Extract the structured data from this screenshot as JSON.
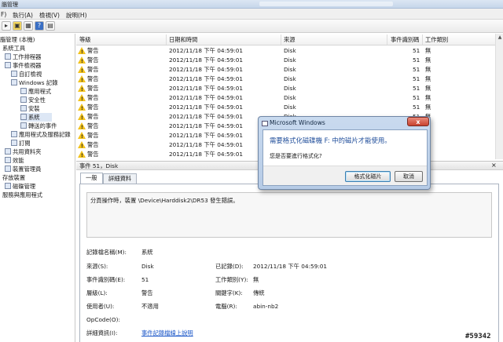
{
  "window": {
    "title": "腦管理"
  },
  "menu": [
    {
      "label": "F)"
    },
    {
      "label": "執行(A)"
    },
    {
      "label": "檢視(V)"
    },
    {
      "label": "說明(H)"
    }
  ],
  "toolbar": {
    "buttons": [
      {
        "icon": "back-icon",
        "glyph": "▸"
      },
      {
        "icon": "folder-icon",
        "glyph": "▣"
      },
      {
        "icon": "grid-icon",
        "glyph": "▦"
      },
      {
        "icon": "help-icon",
        "glyph": "?"
      },
      {
        "icon": "properties-icon",
        "glyph": "▤"
      }
    ]
  },
  "tree": {
    "items": [
      {
        "label": "腦管理 (本機)"
      },
      {
        "label": "系統工具"
      },
      {
        "label": "工作排程器"
      },
      {
        "label": "事件檢視器"
      },
      {
        "label": "自訂檢視"
      },
      {
        "label": "Windows 記錄"
      },
      {
        "label": "應用程式"
      },
      {
        "label": "安全性"
      },
      {
        "label": "安裝"
      },
      {
        "label": "系統"
      },
      {
        "label": "轉送的事件"
      },
      {
        "label": "應用程式及服務記錄"
      },
      {
        "label": "訂閱"
      },
      {
        "label": "共用資料夾"
      },
      {
        "label": "效能"
      },
      {
        "label": "裝置管理員"
      },
      {
        "label": "存放裝置"
      },
      {
        "label": "磁碟管理"
      },
      {
        "label": "服務與應用程式"
      }
    ]
  },
  "list": {
    "columns": [
      "等級",
      "日期和時間",
      "來源",
      "事件識別碼",
      "工作類別"
    ],
    "rows": [
      {
        "level": "警告",
        "datetime": "2012/11/18 下午 04:59:01",
        "source": "Disk",
        "event_id": "51",
        "category": "無"
      },
      {
        "level": "警告",
        "datetime": "2012/11/18 下午 04:59:01",
        "source": "Disk",
        "event_id": "51",
        "category": "無"
      },
      {
        "level": "警告",
        "datetime": "2012/11/18 下午 04:59:01",
        "source": "Disk",
        "event_id": "51",
        "category": "無"
      },
      {
        "level": "警告",
        "datetime": "2012/11/18 下午 04:59:01",
        "source": "Disk",
        "event_id": "51",
        "category": "無"
      },
      {
        "level": "警告",
        "datetime": "2012/11/18 下午 04:59:01",
        "source": "Disk",
        "event_id": "51",
        "category": "無"
      },
      {
        "level": "警告",
        "datetime": "2012/11/18 下午 04:59:01",
        "source": "Disk",
        "event_id": "51",
        "category": "無"
      },
      {
        "level": "警告",
        "datetime": "2012/11/18 下午 04:59:01",
        "source": "Disk",
        "event_id": "51",
        "category": "無"
      },
      {
        "level": "警告",
        "datetime": "2012/11/18 下午 04:59:01",
        "source": "Disk",
        "event_id": "51",
        "category": "無"
      },
      {
        "level": "警告",
        "datetime": "2012/11/18 下午 04:59:01",
        "source": "",
        "event_id": "",
        "category": ""
      },
      {
        "level": "警告",
        "datetime": "2012/11/18 下午 04:59:01",
        "source": "",
        "event_id": "",
        "category": ""
      },
      {
        "level": "警告",
        "datetime": "2012/11/18 下午 04:59:01",
        "source": "",
        "event_id": "",
        "category": ""
      },
      {
        "level": "警告",
        "datetime": "2012/11/18 下午 04:59:01",
        "source": "",
        "event_id": "",
        "category": ""
      }
    ]
  },
  "details": {
    "header": "事件 51，Disk",
    "close": "×",
    "tabs": [
      "一般",
      "詳細資料"
    ],
    "description": "分頁操作時，裝置 \\Device\\Harddisk2\\DR53 發生錯誤。",
    "fields": {
      "log_name_label": "記錄檔名稱(M):",
      "log_name": "系統",
      "source_label": "來源(S):",
      "source": "Disk",
      "logged_label": "已記錄(D):",
      "logged": "2012/11/18 下午 04:59:01",
      "event_id_label": "事件識別碼(E):",
      "event_id": "51",
      "task_label": "工作類別(Y):",
      "task": "無",
      "level_label": "層級(L):",
      "level": "警告",
      "keywords_label": "關鍵字(K):",
      "keywords": "傳統",
      "user_label": "使用者(U):",
      "user": "不適用",
      "computer_label": "電腦(R):",
      "computer": "abin-nb2",
      "opcode_label": "OpCode(O):",
      "more_label": "詳細資訊(I):",
      "more_link": "事件記錄檔線上說明"
    }
  },
  "dialog": {
    "title": "Microsoft Windows",
    "close": "x",
    "message": "需要格式化磁碟機 F: 中的磁片才能使用。",
    "question": "您是否要進行格式化?",
    "format_button": "格式化磁片",
    "cancel_button": "取消"
  },
  "watermark": "#59342"
}
